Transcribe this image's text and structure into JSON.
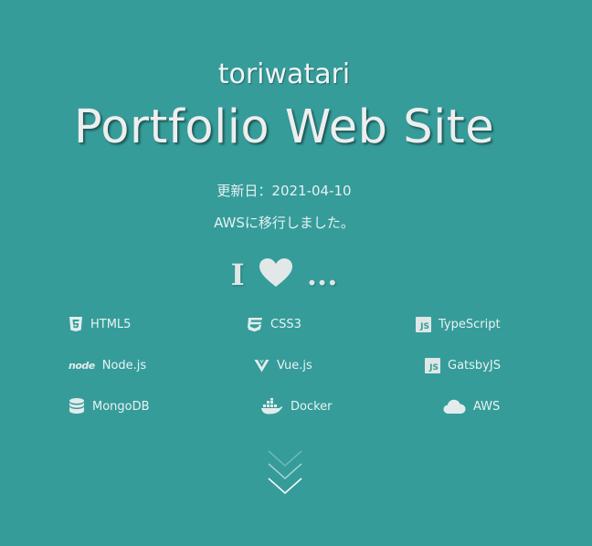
{
  "header": {
    "subtitle": "toriwatari",
    "title": "Portfolio Web Site",
    "updated": "更新日：2021-04-10",
    "notice": "AWSに移行しました。"
  },
  "love": {
    "prefix": "I",
    "suffix": "..."
  },
  "skills": [
    {
      "label": "HTML5",
      "icon": "html5-icon"
    },
    {
      "label": "CSS3",
      "icon": "css3-icon"
    },
    {
      "label": "TypeScript",
      "icon": "typescript-icon"
    },
    {
      "label": "Node.js",
      "icon": "nodejs-icon"
    },
    {
      "label": "Vue.js",
      "icon": "vuejs-icon"
    },
    {
      "label": "GatsbyJS",
      "icon": "gatsbyjs-icon"
    },
    {
      "label": "MongoDB",
      "icon": "mongodb-icon"
    },
    {
      "label": "Docker",
      "icon": "docker-icon"
    },
    {
      "label": "AWS",
      "icon": "aws-cloud-icon"
    }
  ],
  "icons": {
    "js_badge": "JS",
    "node_logo": "node"
  },
  "colors": {
    "background": "#359c9a",
    "text": "#eef5f4"
  }
}
